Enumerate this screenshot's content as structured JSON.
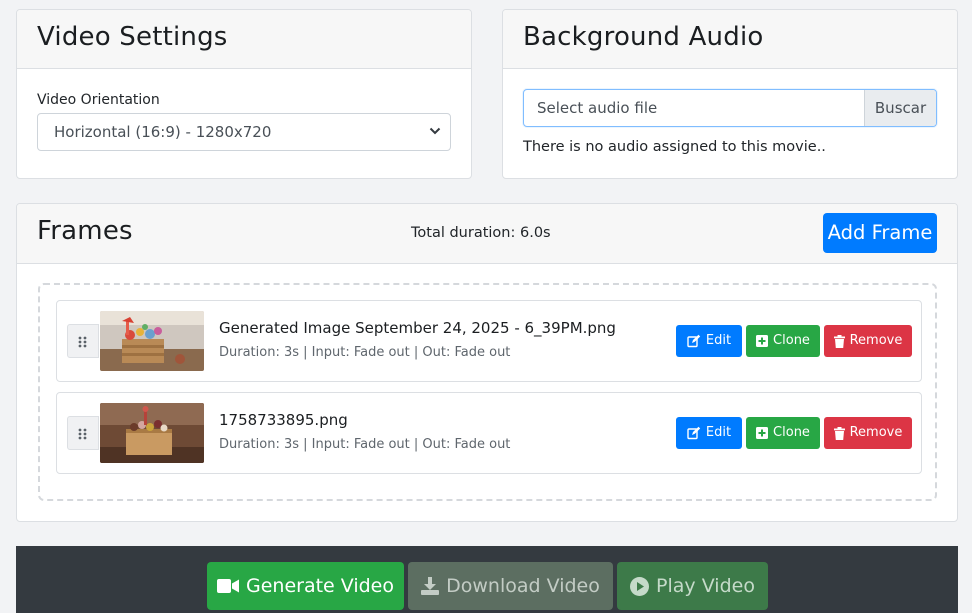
{
  "video_settings": {
    "title": "Video Settings",
    "orientation_label": "Video Orientation",
    "orientation_value": "Horizontal (16:9) - 1280x720"
  },
  "background_audio": {
    "title": "Background Audio",
    "file_placeholder": "Select audio file",
    "browse_label": "Buscar",
    "note": "There is no audio assigned to this movie.."
  },
  "frames": {
    "title": "Frames",
    "total_duration": "Total duration: 6.0s",
    "add_label": "Add Frame",
    "items": [
      {
        "name": "Generated Image September 24, 2025 - 6_39PM.png",
        "meta": "Duration: 3s | Input: Fade out | Out: Fade out"
      },
      {
        "name": "1758733895.png",
        "meta": "Duration: 3s | Input: Fade out | Out: Fade out"
      }
    ],
    "edit_label": "Edit",
    "clone_label": "Clone",
    "remove_label": "Remove"
  },
  "footer": {
    "generate_label": "Generate Video",
    "download_label": "Download Video",
    "play_label": "Play Video"
  },
  "icons": {
    "edit": "edit-icon",
    "clone": "plus-square-icon",
    "remove": "trash-icon",
    "drag": "grip-icon",
    "video": "video-camera-icon",
    "download": "download-icon",
    "play": "play-circle-icon"
  },
  "colors": {
    "primary": "#007bff",
    "success": "#28a745",
    "danger": "#dc3545",
    "dark": "#343a40"
  }
}
